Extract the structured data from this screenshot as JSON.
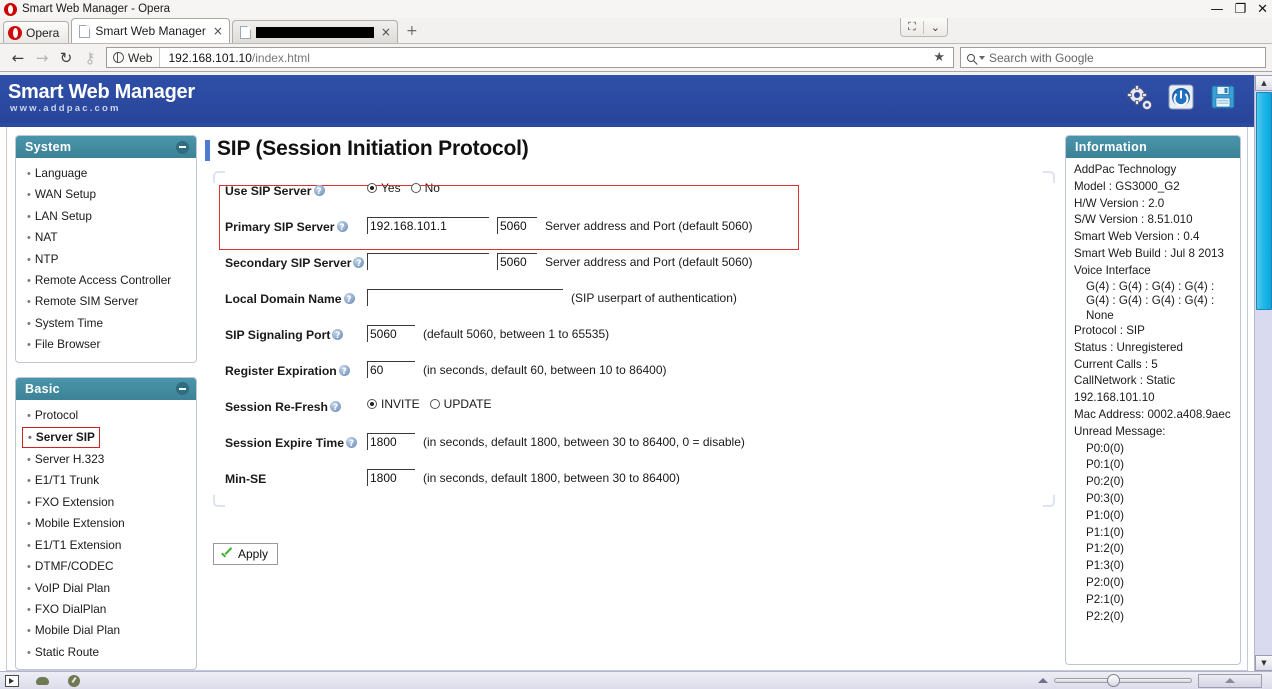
{
  "browser": {
    "window_title": "Smart Web Manager - Opera",
    "opera_button": "Opera",
    "tabs": [
      {
        "label": "Smart Web Manager",
        "active": true,
        "redacted": false
      },
      {
        "label": "",
        "active": false,
        "redacted": true
      }
    ],
    "new_tab_label": "+",
    "tab_close_label": "×",
    "window_controls": {
      "minimize": "—",
      "restore": "❐",
      "close": "✕"
    },
    "tab_controls": {
      "expand": "⛶",
      "dropdown": "⌄"
    },
    "nav": {
      "back": "←",
      "forward": "→",
      "reload": "↻",
      "key": "⚷"
    },
    "address": {
      "badge_label": "Web",
      "url_host": "192.168.101.10",
      "url_path": "/index.html",
      "bookmark_star": "★"
    },
    "search": {
      "placeholder": "Search with Google",
      "value": ""
    }
  },
  "app": {
    "brand_title": "Smart Web Manager",
    "brand_sub": "www.addpac.com",
    "header_icons": [
      {
        "name": "settings-gear-icon",
        "label": "Settings"
      },
      {
        "name": "power-icon",
        "label": "Reboot"
      },
      {
        "name": "save-floppy-icon",
        "label": "Save"
      }
    ]
  },
  "sidebar": {
    "panels": [
      {
        "title": "System",
        "collapse_label": "−",
        "items": [
          {
            "label": "Language",
            "selected": false
          },
          {
            "label": "WAN Setup",
            "selected": false
          },
          {
            "label": "LAN Setup",
            "selected": false
          },
          {
            "label": "NAT",
            "selected": false
          },
          {
            "label": "NTP",
            "selected": false
          },
          {
            "label": "Remote Access Controller",
            "selected": false
          },
          {
            "label": "Remote SIM Server",
            "selected": false
          },
          {
            "label": "System Time",
            "selected": false
          },
          {
            "label": "File Browser",
            "selected": false
          }
        ]
      },
      {
        "title": "Basic",
        "collapse_label": "−",
        "items": [
          {
            "label": "Protocol",
            "selected": false
          },
          {
            "label": "Server SIP",
            "selected": true
          },
          {
            "label": "Server H.323",
            "selected": false
          },
          {
            "label": "E1/T1 Trunk",
            "selected": false
          },
          {
            "label": "FXO Extension",
            "selected": false
          },
          {
            "label": "Mobile Extension",
            "selected": false
          },
          {
            "label": "E1/T1 Extension",
            "selected": false
          },
          {
            "label": "DTMF/CODEC",
            "selected": false
          },
          {
            "label": "VoIP Dial Plan",
            "selected": false
          },
          {
            "label": "FXO DialPlan",
            "selected": false
          },
          {
            "label": "Mobile Dial Plan",
            "selected": false
          },
          {
            "label": "Static Route",
            "selected": false
          }
        ]
      }
    ]
  },
  "main": {
    "page_title": "SIP (Session Initiation Protocol)",
    "rows": [
      {
        "id": "use-sip-server",
        "label": "Use SIP Server",
        "help": true,
        "type": "radio",
        "options": [
          {
            "label": "Yes",
            "checked": true
          },
          {
            "label": "No",
            "checked": false
          }
        ],
        "hint": "",
        "highlighted": true
      },
      {
        "id": "primary-sip-server",
        "label": "Primary SIP Server",
        "help": true,
        "type": "addr-port",
        "address": "192.168.101.1",
        "port": "5060",
        "hint": "Server address and Port (default 5060)",
        "highlighted": true
      },
      {
        "id": "secondary-sip-server",
        "label": "Secondary SIP Server",
        "help": true,
        "type": "addr-port",
        "address": "",
        "port": "5060",
        "hint": "Server address and Port (default 5060)",
        "highlighted": false
      },
      {
        "id": "local-domain-name",
        "label": "Local Domain Name",
        "help": true,
        "type": "domain",
        "value": "",
        "hint": "(SIP userpart of authentication)",
        "highlighted": false
      },
      {
        "id": "sip-signaling-port",
        "label": "SIP Signaling Port",
        "help": true,
        "type": "number",
        "value": "5060",
        "hint": "(default 5060, between 1 to 65535)",
        "highlighted": false
      },
      {
        "id": "register-expiration",
        "label": "Register Expiration",
        "help": true,
        "type": "number",
        "value": "60",
        "hint": "(in seconds, default 60, between 10 to 86400)",
        "highlighted": false
      },
      {
        "id": "session-refresh",
        "label": "Session Re-Fresh",
        "help": true,
        "type": "radio",
        "options": [
          {
            "label": "INVITE",
            "checked": true
          },
          {
            "label": "UPDATE",
            "checked": false
          }
        ],
        "hint": "",
        "highlighted": false
      },
      {
        "id": "session-expire-time",
        "label": "Session Expire Time",
        "help": true,
        "type": "number",
        "value": "1800",
        "hint": "(in seconds, default 1800, between 30 to 86400, 0 = disable)",
        "highlighted": false
      },
      {
        "id": "min-se",
        "label": "Min-SE",
        "help": false,
        "type": "number",
        "value": "1800",
        "hint": "(in seconds, default 1800, between 30 to 86400)",
        "highlighted": false
      }
    ],
    "apply_label": "Apply"
  },
  "information": {
    "title": "Information",
    "lines": [
      {
        "text": "AddPac Technology",
        "indent": 0
      },
      {
        "text": "Model : GS3000_G2",
        "indent": 0
      },
      {
        "text": "H/W Version : 2.0",
        "indent": 0
      },
      {
        "text": "S/W Version : 8.51.010",
        "indent": 0
      },
      {
        "text": "Smart Web Version : 0.4",
        "indent": 0
      },
      {
        "text": "Smart Web Build : Jul 8 2013",
        "indent": 0
      },
      {
        "text": "Voice Interface",
        "indent": 0
      },
      {
        "text": "G(4) : G(4) : G(4) : G(4) : G(4) : G(4) : G(4) : G(4) : None",
        "indent": 1
      },
      {
        "text": "Protocol : SIP",
        "indent": 0
      },
      {
        "text": "Status : Unregistered",
        "indent": 0
      },
      {
        "text": "Current Calls : 5",
        "indent": 0
      },
      {
        "text": "CallNetwork : Static 192.168.101.10",
        "indent": 0
      },
      {
        "text": "Mac Address: 0002.a408.9aec",
        "indent": 0
      },
      {
        "text": "Unread Message:",
        "indent": 0
      },
      {
        "text": "P0:0(0)",
        "indent": 1
      },
      {
        "text": "P0:1(0)",
        "indent": 1
      },
      {
        "text": "P0:2(0)",
        "indent": 1
      },
      {
        "text": "P0:3(0)",
        "indent": 1
      },
      {
        "text": "P1:0(0)",
        "indent": 1
      },
      {
        "text": "P1:1(0)",
        "indent": 1
      },
      {
        "text": "P1:2(0)",
        "indent": 1
      },
      {
        "text": "P1:3(0)",
        "indent": 1
      },
      {
        "text": "P2:0(0)",
        "indent": 1
      },
      {
        "text": "P2:1(0)",
        "indent": 1
      },
      {
        "text": "P2:2(0)",
        "indent": 1
      }
    ]
  },
  "statusbar": {
    "icons": [
      {
        "name": "panel-toggle-icon"
      },
      {
        "name": "cloud-icon"
      },
      {
        "name": "speed-dial-icon"
      }
    ],
    "zoom_up_label": "▲"
  },
  "colors": {
    "brand_blue": "#2b4ba0",
    "panel_teal": "#3d8296",
    "highlight_red": "#e03030",
    "scrollbar_cyan": "#17b4e8",
    "accent_bar": "#4e7bd0"
  }
}
